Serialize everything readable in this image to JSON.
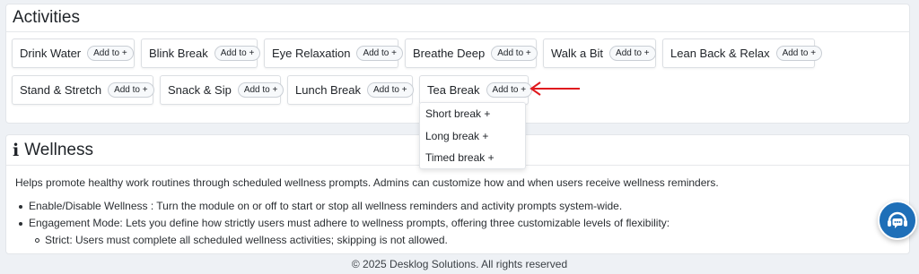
{
  "activities": {
    "title": "Activities",
    "add_label": "Add to +",
    "row1": [
      {
        "label": "Drink Water"
      },
      {
        "label": "Blink Break"
      },
      {
        "label": "Eye Relaxation"
      },
      {
        "label": "Breathe Deep"
      },
      {
        "label": "Walk a Bit"
      },
      {
        "label": "Lean Back & Relax"
      }
    ],
    "row2": [
      {
        "label": "Stand & Stretch"
      },
      {
        "label": "Snack & Sip"
      },
      {
        "label": "Lunch Break"
      },
      {
        "label": "Tea Break"
      }
    ]
  },
  "dropdown": {
    "items": [
      "Short break +",
      "Long break +",
      "Timed break +"
    ]
  },
  "wellness": {
    "title": "Wellness",
    "intro": "Helps promote healthy work routines through scheduled wellness prompts. Admins can customize how and when users receive wellness reminders.",
    "bullets": [
      "Enable/Disable Wellness : Turn the module on or off to start or stop all wellness reminders and activity prompts system-wide.",
      "Engagement Mode: Lets you define how strictly users must adhere to wellness prompts, offering three customizable levels of flexibility:"
    ],
    "sub_bullets": [
      "Strict: Users must complete all scheduled wellness activities; skipping is not allowed."
    ]
  },
  "footer": {
    "text": "© 2025 Desklog Solutions. All rights reserved"
  },
  "colors": {
    "accent": "#1e6fb8",
    "annotation_arrow": "#e0191e"
  },
  "icons": {
    "wellness_icon": "info-icon",
    "chat": "headset-chat-icon"
  }
}
